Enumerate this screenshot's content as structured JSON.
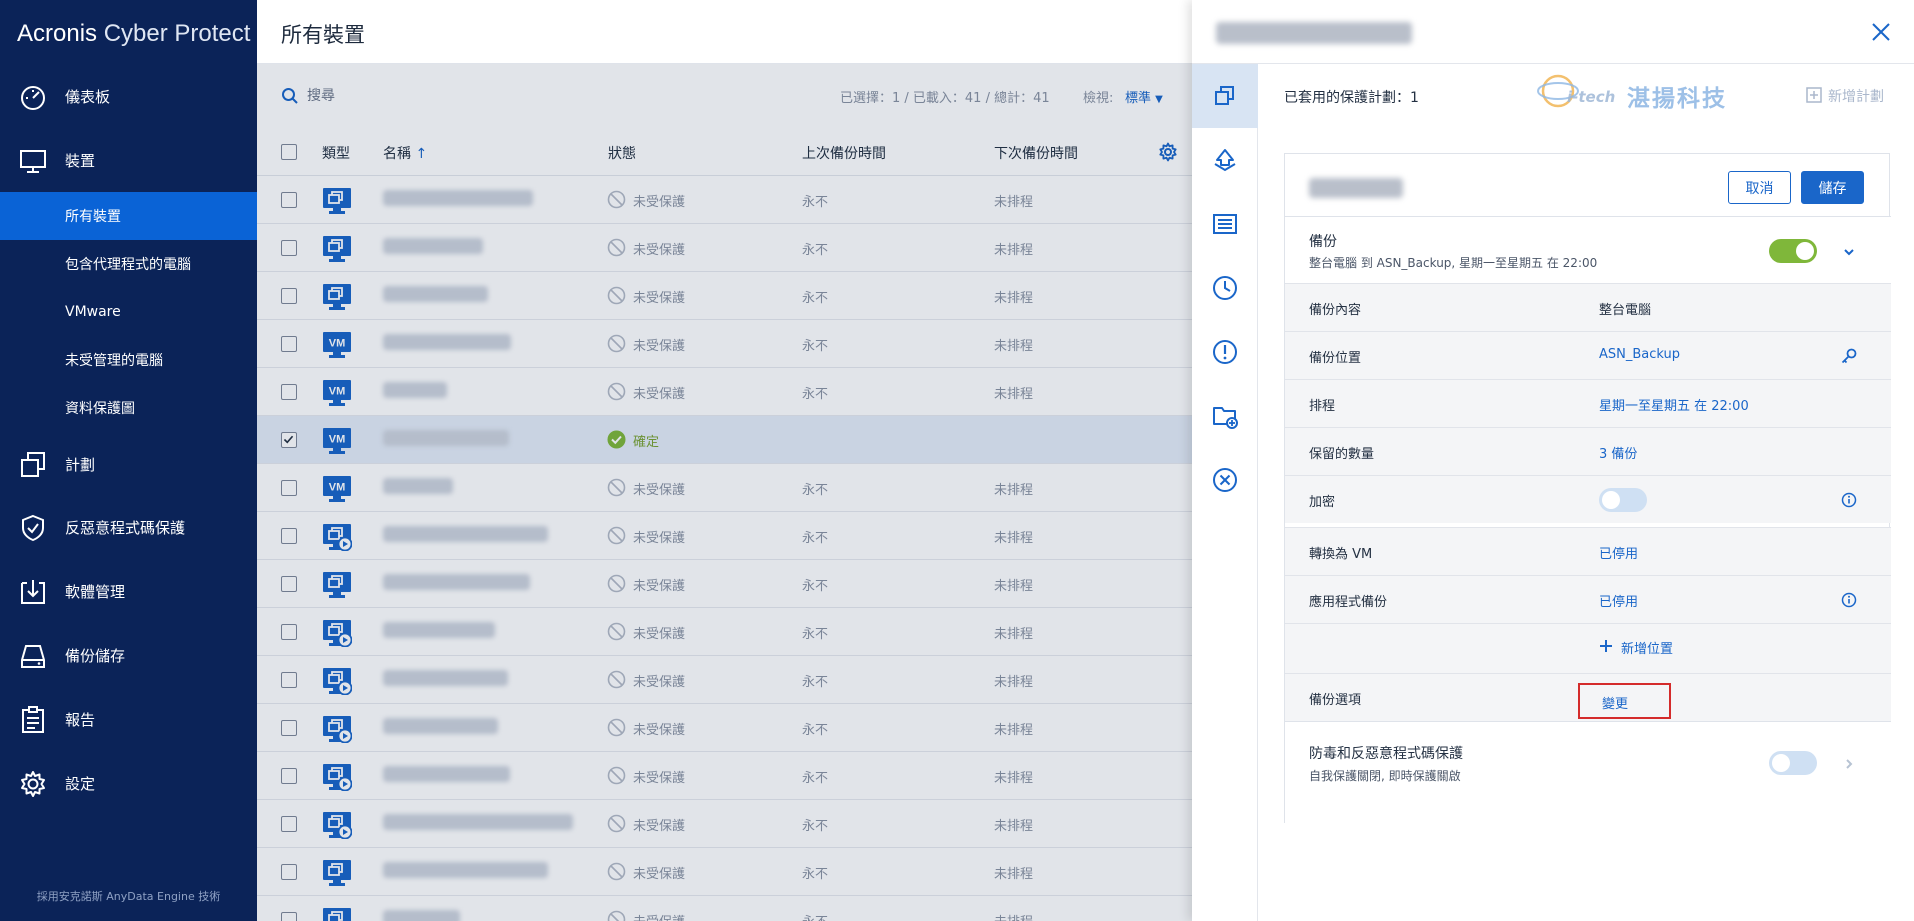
{
  "brand": {
    "name_bold": "Acronis",
    "name_light": "Cyber Protect"
  },
  "sidebar": {
    "items": [
      {
        "label": "儀表板",
        "icon": "dashboard-icon"
      },
      {
        "label": "裝置",
        "icon": "monitor-icon"
      },
      {
        "label": "計劃",
        "icon": "plans-icon"
      },
      {
        "label": "反惡意程式碼保護",
        "icon": "shield-icon"
      },
      {
        "label": "軟體管理",
        "icon": "software-icon"
      },
      {
        "label": "備份儲存",
        "icon": "storage-icon"
      },
      {
        "label": "報告",
        "icon": "report-icon"
      },
      {
        "label": "設定",
        "icon": "gear-icon"
      }
    ],
    "sub_items": [
      {
        "label": "所有裝置",
        "active": true
      },
      {
        "label": "包含代理程式的電腦"
      },
      {
        "label": "VMware"
      },
      {
        "label": "未受管理的電腦"
      },
      {
        "label": "資料保護圖"
      }
    ],
    "footer": "採用安克諾斯 AnyData Engine 技術"
  },
  "main": {
    "title": "所有裝置",
    "search": {
      "placeholder": "搜尋"
    },
    "counts": "已選擇：1 / 已載入：41 / 總計：41",
    "view_label": "檢視:",
    "view_value": "標準",
    "columns": {
      "type": "類型",
      "name": "名稱",
      "status": "狀態",
      "last_backup": "上次備份時間",
      "next_backup": "下次備份時間"
    },
    "rows": [
      {
        "type": "agent",
        "status": "未受保護",
        "last": "永不",
        "next": "未排程",
        "selected": false
      },
      {
        "type": "agent",
        "status": "未受保護",
        "last": "永不",
        "next": "未排程",
        "selected": false
      },
      {
        "type": "agent",
        "status": "未受保護",
        "last": "永不",
        "next": "未排程",
        "selected": false
      },
      {
        "type": "vm",
        "status": "未受保護",
        "last": "永不",
        "next": "未排程",
        "selected": false
      },
      {
        "type": "vm",
        "status": "未受保護",
        "last": "永不",
        "next": "未排程",
        "selected": false
      },
      {
        "type": "vm",
        "status": "確定",
        "last": "",
        "next": "",
        "selected": true
      },
      {
        "type": "vm",
        "status": "未受保護",
        "last": "永不",
        "next": "未排程",
        "selected": false
      },
      {
        "type": "agent-play",
        "status": "未受保護",
        "last": "永不",
        "next": "未排程",
        "selected": false
      },
      {
        "type": "agent",
        "status": "未受保護",
        "last": "永不",
        "next": "未排程",
        "selected": false
      },
      {
        "type": "agent-play",
        "status": "未受保護",
        "last": "永不",
        "next": "未排程",
        "selected": false
      },
      {
        "type": "agent-play",
        "status": "未受保護",
        "last": "永不",
        "next": "未排程",
        "selected": false
      },
      {
        "type": "agent-play",
        "status": "未受保護",
        "last": "永不",
        "next": "未排程",
        "selected": false
      },
      {
        "type": "agent-play",
        "status": "未受保護",
        "last": "永不",
        "next": "未排程",
        "selected": false
      },
      {
        "type": "agent-play",
        "status": "未受保護",
        "last": "永不",
        "next": "未排程",
        "selected": false
      },
      {
        "type": "agent",
        "status": "未受保護",
        "last": "永不",
        "next": "未排程",
        "selected": false
      },
      {
        "type": "agent",
        "status": "未受保護",
        "last": "永不",
        "next": "未排程",
        "selected": false
      }
    ]
  },
  "panel": {
    "applied_plans": "已套用的保護計劃：1",
    "watermark": {
      "brand": "i-tech",
      "text": "湛揚科技"
    },
    "add_plan": "新增計劃",
    "cancel": "取消",
    "save": "儲存",
    "backup": {
      "title": "備份",
      "summary": "整台電腦 到 ASN_Backup, 星期一至星期五 在 22:00",
      "enabled": true,
      "rows": [
        {
          "key": "備份內容",
          "value": "整台電腦"
        },
        {
          "key": "備份位置",
          "value": "ASN_Backup"
        },
        {
          "key": "排程",
          "value": "星期一至星期五 在 22:00"
        },
        {
          "key": "保留的數量",
          "value": "3 備份"
        },
        {
          "key": "加密",
          "value": ""
        },
        {
          "key": "轉換為 VM",
          "value": "已停用"
        },
        {
          "key": "應用程式備份",
          "value": "已停用"
        }
      ],
      "add_location": "新增位置",
      "options_label": "備份選項",
      "options_action": "變更"
    },
    "antimalware": {
      "title": "防毒和反惡意程式碼保護",
      "summary": "自我保護關閉, 即時保護關啟",
      "enabled": false
    }
  },
  "colors": {
    "sidebar": "#0b2358",
    "active": "#0a63d6",
    "link": "#1a66c9",
    "toggle_on": "#7fb73a",
    "ok": "#7aa232",
    "highlight": "#d42b2b"
  }
}
